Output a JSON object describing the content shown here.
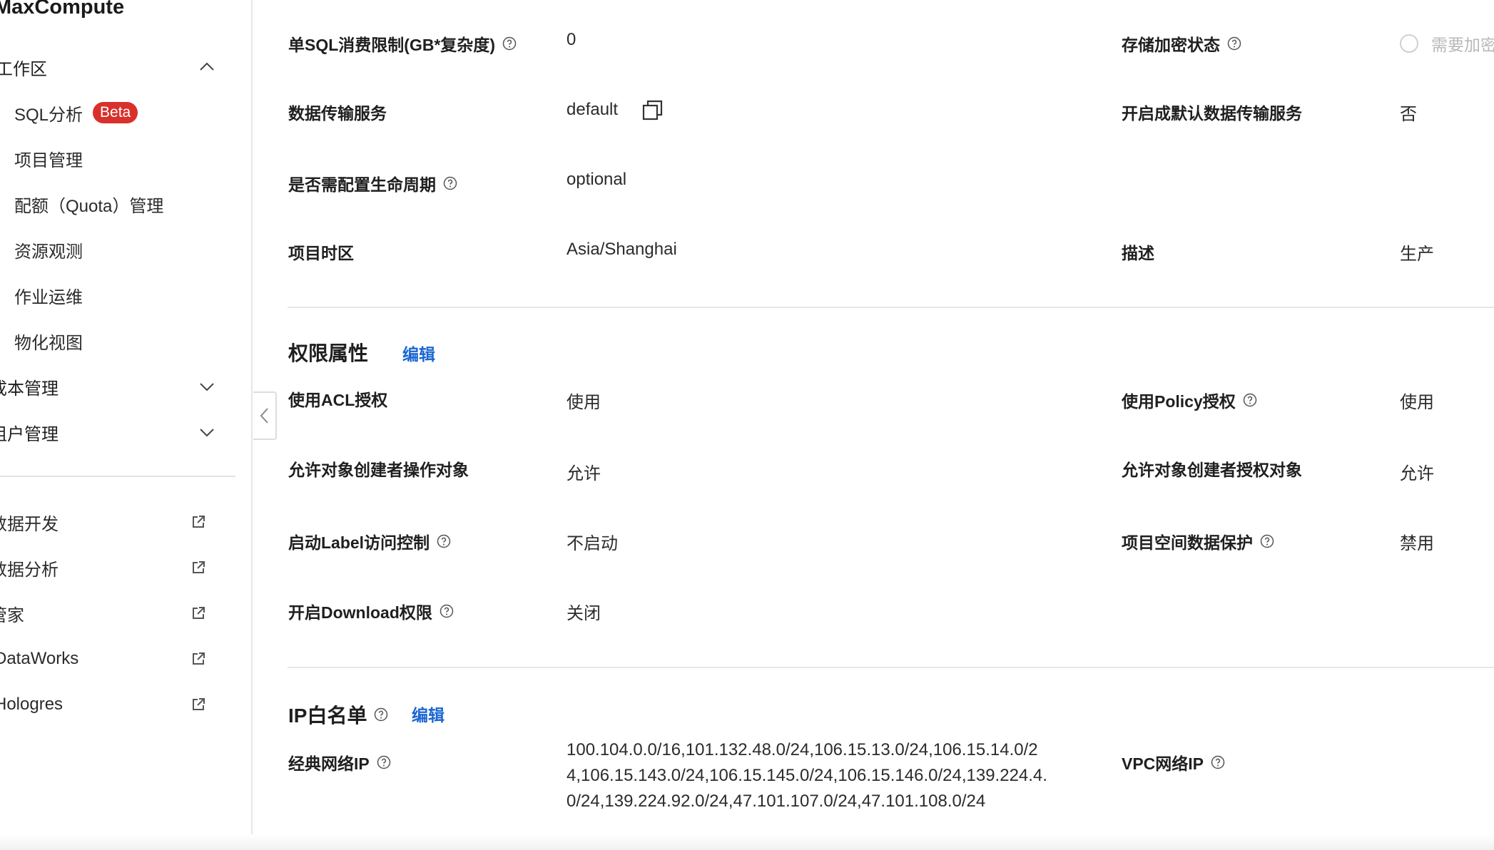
{
  "sidebar": {
    "app_title": "MaxCompute",
    "workspace_group": "工作区",
    "workspace_items": [
      {
        "label": "SQL分析",
        "badge": "Beta"
      },
      {
        "label": "项目管理"
      },
      {
        "label": "配额（Quota）管理"
      },
      {
        "label": "资源观测"
      },
      {
        "label": "作业运维"
      },
      {
        "label": "物化视图"
      }
    ],
    "cost_group": "成本管理",
    "tenant_group": "租户管理",
    "external_links": [
      {
        "label": "数据开发",
        "icon": "external-link-icon"
      },
      {
        "label": "数据分析",
        "icon": "external-link-icon"
      },
      {
        "label": "管家",
        "icon": "external-link-icon"
      },
      {
        "label": "DataWorks",
        "icon": "external-link-icon"
      },
      {
        "label": "Hologres",
        "icon": "external-link-icon"
      }
    ],
    "collapse_icon": "chevron-left-icon"
  },
  "basic_props": {
    "sql_limit": {
      "label": "单SQL消费限制(GB*复杂度)",
      "value": "0"
    },
    "storage_encryption": {
      "label": "存储加密状态",
      "option": "需要加密"
    },
    "transfer_service": {
      "label": "数据传输服务",
      "value": "default"
    },
    "default_transfer": {
      "label": "开启成默认数据传输服务",
      "value": "否"
    },
    "lifecycle": {
      "label": "是否需配置生命周期",
      "value": "optional"
    },
    "timezone": {
      "label": "项目时区",
      "value": "Asia/Shanghai"
    },
    "description": {
      "label": "描述",
      "value": "生产"
    }
  },
  "permission": {
    "title": "权限属性",
    "edit": "编辑",
    "acl": {
      "label": "使用ACL授权",
      "value": "使用"
    },
    "policy": {
      "label": "使用Policy授权",
      "value": "使用"
    },
    "creator_operate": {
      "label": "允许对象创建者操作对象",
      "value": "允许"
    },
    "creator_grant": {
      "label": "允许对象创建者授权对象",
      "value": "允许"
    },
    "label_control": {
      "label": "启动Label访问控制",
      "value": "不启动"
    },
    "data_protection": {
      "label": "项目空间数据保护",
      "value": "禁用"
    },
    "download": {
      "label": "开启Download权限",
      "value": "关闭"
    }
  },
  "ip_whitelist": {
    "title": "IP白名单",
    "edit": "编辑",
    "classic": {
      "label": "经典网络IP",
      "value": "100.104.0.0/16,101.132.48.0/24,106.15.13.0/24,106.15.14.0/24,106.15.143.0/24,106.15.145.0/24,106.15.146.0/24,139.224.4.0/24,139.224.92.0/24,47.101.107.0/24,47.101.108.0/24"
    },
    "vpc": {
      "label": "VPC网络IP"
    }
  },
  "colors": {
    "accent": "#1a67d2",
    "badge": "#d9302b"
  }
}
